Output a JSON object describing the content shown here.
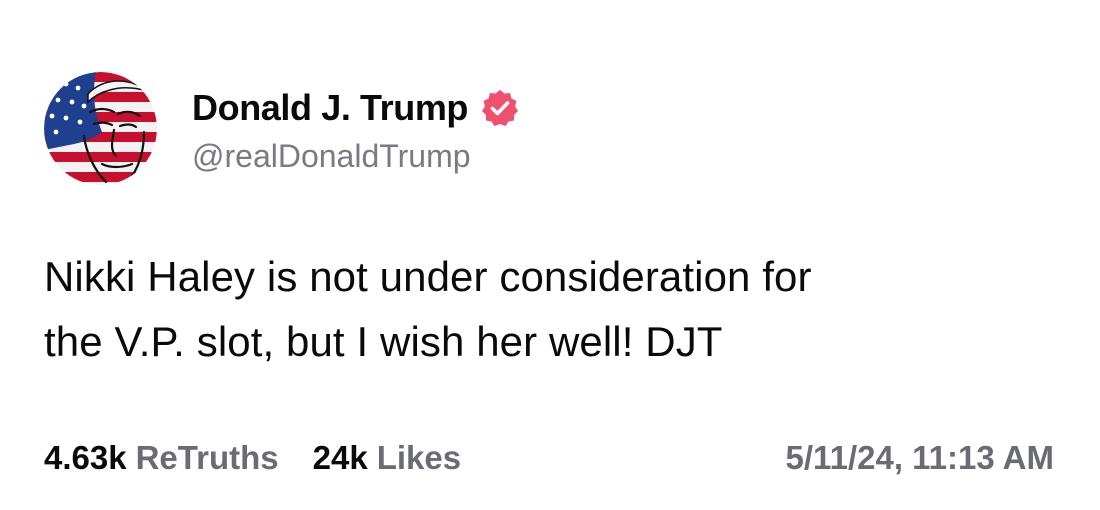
{
  "post": {
    "author": {
      "display_name": "Donald J. Trump",
      "handle": "@realDonaldTrump",
      "verified": true,
      "verified_color": "#f0506e",
      "avatar_icon": "flag-portrait-avatar"
    },
    "text_lines": [
      "Nikki Haley is not under consideration for",
      "the V.P. slot, but I wish her well! DJT"
    ],
    "stats": {
      "retruths_count": "4.63k",
      "retruths_label": "ReTruths",
      "likes_count": "24k",
      "likes_label": "Likes"
    },
    "timestamp": "5/11/24, 11:13 AM"
  }
}
